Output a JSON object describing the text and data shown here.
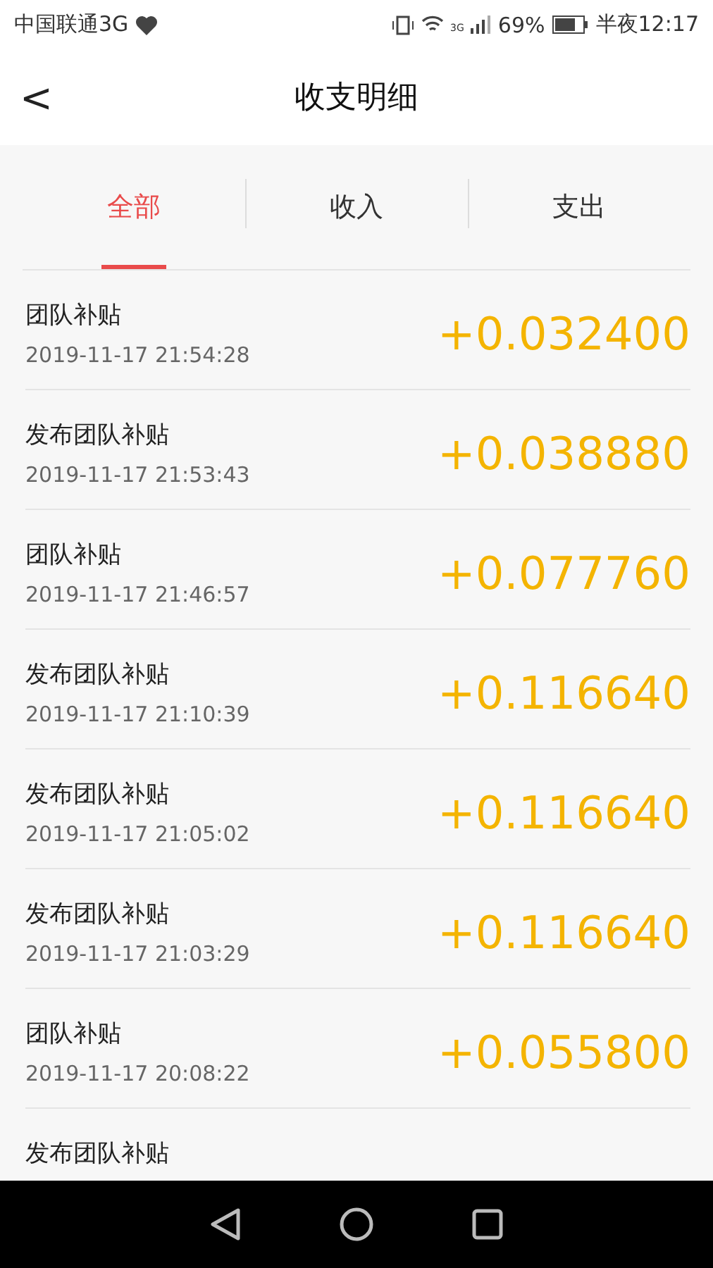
{
  "status_bar": {
    "carrier": "中国联通3G",
    "network": "3G",
    "battery": "69%",
    "time": "半夜12:17"
  },
  "header": {
    "back": "<",
    "title": "收支明细"
  },
  "tabs": [
    {
      "label": "全部",
      "selected": true
    },
    {
      "label": "收入",
      "selected": false
    },
    {
      "label": "支出",
      "selected": false
    }
  ],
  "records": [
    {
      "title": "团队补贴",
      "time": "2019-11-17 21:54:28",
      "amount": "+0.032400"
    },
    {
      "title": "发布团队补贴",
      "time": "2019-11-17 21:53:43",
      "amount": "+0.038880"
    },
    {
      "title": "团队补贴",
      "time": "2019-11-17 21:46:57",
      "amount": "+0.077760"
    },
    {
      "title": "发布团队补贴",
      "time": "2019-11-17 21:10:39",
      "amount": "+0.116640"
    },
    {
      "title": "发布团队补贴",
      "time": "2019-11-17 21:05:02",
      "amount": "+0.116640"
    },
    {
      "title": "发布团队补贴",
      "time": "2019-11-17 21:03:29",
      "amount": "+0.116640"
    },
    {
      "title": "团队补贴",
      "time": "2019-11-17 20:08:22",
      "amount": "+0.055800"
    },
    {
      "title": "发布团队补贴"
    }
  ]
}
